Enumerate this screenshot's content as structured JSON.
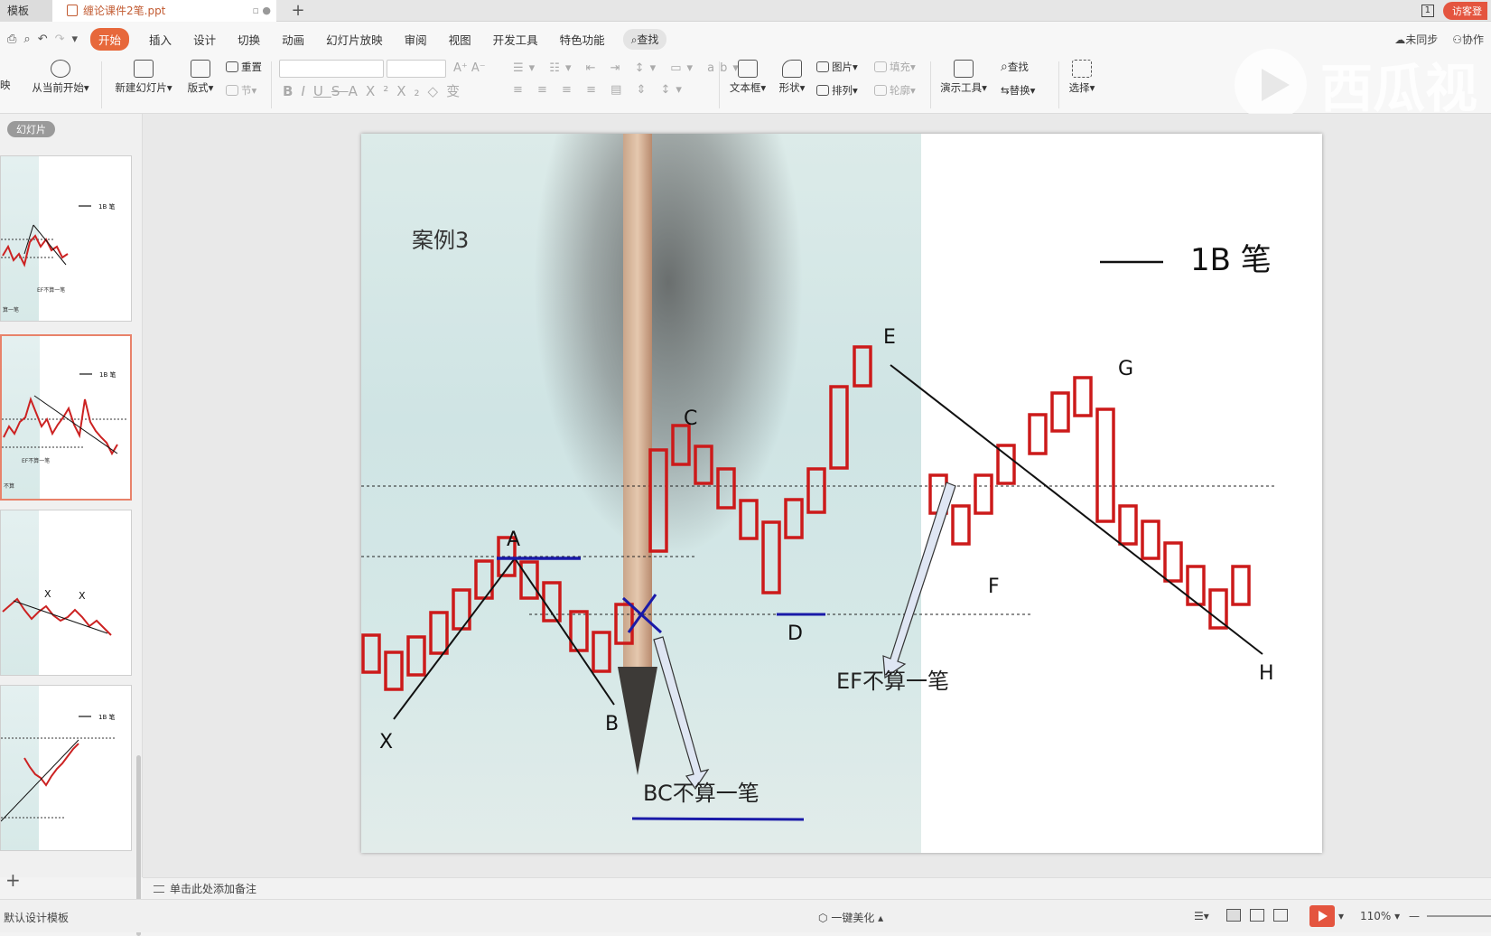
{
  "tabs": {
    "template": "模板",
    "document": "缠论课件2笔.ppt",
    "add": "+"
  },
  "title_right": {
    "window_count": "1",
    "visitor": "访客登"
  },
  "menu": {
    "items": [
      "开始",
      "插入",
      "设计",
      "切换",
      "动画",
      "幻灯片放映",
      "审阅",
      "视图",
      "开发工具",
      "特色功能"
    ],
    "search": "查找",
    "sync": "未同步",
    "collab": "协作"
  },
  "ribbon": {
    "play_from_current": "从当前开始",
    "play_partial": "映",
    "new_slide": "新建幻灯片",
    "layout": "版式",
    "reset": "重置",
    "section": "节",
    "format_bold": "B",
    "format_italic": "I",
    "format_underline": "U",
    "format_strike": "S",
    "format_color": "A",
    "format_sup": "X²",
    "format_sub": "X₂",
    "format_clear": "◇",
    "format_more": "变",
    "text_box": "文本框",
    "shapes": "形状",
    "picture": "图片",
    "arrange": "排列",
    "fill": "填充",
    "outline": "轮廓",
    "present_tools": "演示工具",
    "find": "查找",
    "replace": "替换",
    "select": "选择"
  },
  "watermark": "西瓜视",
  "thumb_panel": {
    "label": "幻灯片",
    "add": "+"
  },
  "thumbs": [
    {
      "legend": "1B 笔",
      "note": "EF不算一笔",
      "side": "算一笔"
    },
    {
      "legend": "1B 笔",
      "note": "EF不算一笔",
      "side": "不算"
    },
    {
      "marks": [
        "X",
        "X"
      ]
    },
    {
      "legend": "1B 笔"
    }
  ],
  "slide": {
    "title": "案例3",
    "legend": "1B  笔",
    "labels": {
      "X": "X",
      "A": "A",
      "B": "B",
      "C": "C",
      "D": "D",
      "E": "E",
      "F": "F",
      "G": "G",
      "H": "H"
    },
    "note_bc": "BC不算一笔",
    "note_ef": "EF不算一笔"
  },
  "chart_data": {
    "type": "candlestick-sketch",
    "title": "案例3",
    "legend": "1B 笔",
    "points": [
      "X",
      "A",
      "B",
      "C",
      "D",
      "E",
      "F",
      "G",
      "H"
    ],
    "strokes": [
      [
        "X",
        "A"
      ],
      [
        "A",
        "B"
      ],
      [
        "E",
        "H"
      ]
    ],
    "annotations": [
      "BC不算一笔",
      "EF不算一笔"
    ],
    "colors": {
      "candles": "#cc1a1a",
      "strokes": "#111111",
      "marker": "#1a1aa8",
      "arrow_fill": "#dfe6f3"
    }
  },
  "notes": "单击此处添加备注",
  "status": {
    "theme": "默认设计模板",
    "beautify": "一键美化",
    "zoom": "110%"
  }
}
